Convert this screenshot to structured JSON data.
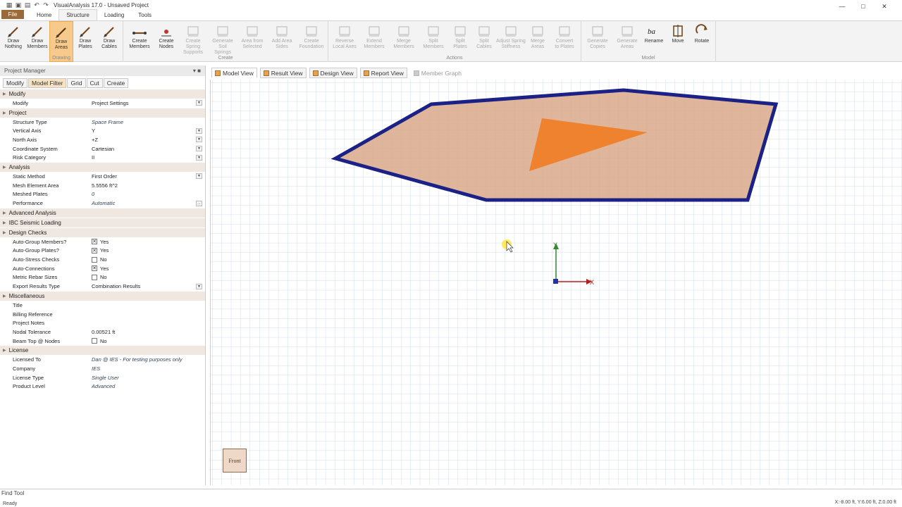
{
  "title_bar": {
    "app_title": "VisualAnalysis 17.0 - Unsaved Project",
    "qat_icons": [
      "app-icon",
      "save-icon",
      "save-all-icon",
      "undo-icon",
      "redo-icon"
    ],
    "window_controls": [
      "minimize-icon",
      "maximize-icon",
      "close-icon"
    ]
  },
  "ribbon_tabs": {
    "file": "File",
    "tabs": [
      {
        "label": "Home",
        "active": false
      },
      {
        "label": "Structure",
        "active": true
      },
      {
        "label": "Loading",
        "active": false
      },
      {
        "label": "Tools",
        "active": false
      }
    ]
  },
  "ribbon": {
    "groups": [
      {
        "label": "Drawing",
        "buttons": [
          {
            "label": "Draw\nNothing",
            "icon": "pencil-icon",
            "enabled": true,
            "active": false
          },
          {
            "label": "Draw\nMembers",
            "icon": "draw-member-icon",
            "enabled": true,
            "active": false
          },
          {
            "label": "Draw\nAreas",
            "icon": "draw-area-icon",
            "enabled": true,
            "active": true
          },
          {
            "label": "Draw\nPlates",
            "icon": "draw-plate-icon",
            "enabled": true,
            "active": false
          },
          {
            "label": "Draw\nCables",
            "icon": "draw-cable-icon",
            "enabled": true,
            "active": false
          }
        ]
      },
      {
        "label": "Create",
        "buttons": [
          {
            "label": "Create\nMembers",
            "icon": "create-members-icon",
            "enabled": true,
            "active": false
          },
          {
            "label": "Create\nNodes",
            "icon": "create-nodes-icon",
            "enabled": true,
            "active": false
          },
          {
            "label": "Create Spring\nSupports",
            "icon": "spring-support-icon",
            "enabled": false,
            "active": false
          },
          {
            "label": "Generate Soil\nSprings",
            "icon": "soil-spring-icon",
            "enabled": false,
            "active": false
          },
          {
            "label": "Area from\nSelected",
            "icon": "area-from-selected-icon",
            "enabled": false,
            "active": false
          },
          {
            "label": "Add Area\nSides",
            "icon": "add-area-sides-icon",
            "enabled": false,
            "active": false
          },
          {
            "label": "Create\nFoundation",
            "icon": "foundation-icon",
            "enabled": false,
            "active": false
          }
        ]
      },
      {
        "label": "Actions",
        "buttons": [
          {
            "label": "Reverse\nLocal Axes",
            "icon": "reverse-axes-icon",
            "enabled": false,
            "active": false
          },
          {
            "label": "Extend\nMembers",
            "icon": "extend-members-icon",
            "enabled": false,
            "active": false
          },
          {
            "label": "Merge\nMembers",
            "icon": "merge-members-icon",
            "enabled": false,
            "active": false
          },
          {
            "label": "Split\nMembers",
            "icon": "split-members-icon",
            "enabled": false,
            "active": false
          },
          {
            "label": "Split\nPlates",
            "icon": "split-plates-icon",
            "enabled": false,
            "active": false
          },
          {
            "label": "Split\nCables",
            "icon": "split-cables-icon",
            "enabled": false,
            "active": false
          },
          {
            "label": "Adjust Spring\nStiffness",
            "icon": "spring-stiffness-icon",
            "enabled": false,
            "active": false
          },
          {
            "label": "Merge\nAreas",
            "icon": "merge-areas-icon",
            "enabled": false,
            "active": false
          },
          {
            "label": "Convert\nto Plates",
            "icon": "convert-plates-icon",
            "enabled": false,
            "active": false
          }
        ]
      },
      {
        "label": "Model",
        "buttons": [
          {
            "label": "Generate\nCopies",
            "icon": "generate-copies-icon",
            "enabled": false,
            "active": false
          },
          {
            "label": "Generate\nAreas",
            "icon": "generate-areas-icon",
            "enabled": false,
            "active": false
          },
          {
            "label": "Rename",
            "icon": "rename-icon",
            "enabled": true,
            "active": false
          },
          {
            "label": "Move",
            "icon": "move-icon",
            "enabled": true,
            "active": false
          },
          {
            "label": "Rotate",
            "icon": "rotate-icon",
            "enabled": true,
            "active": false
          }
        ]
      }
    ]
  },
  "project_manager": {
    "title": "Project Manager",
    "tabs": [
      {
        "label": "Modify",
        "active": false
      },
      {
        "label": "Model Filter",
        "active": true
      },
      {
        "label": "Grid",
        "active": false
      },
      {
        "label": "Cut",
        "active": false
      },
      {
        "label": "Create",
        "active": false
      }
    ],
    "sections": [
      {
        "title": "Modify",
        "rows": [
          {
            "key": "Modify",
            "value": "Project Settings",
            "type": "dropdown",
            "italic": false
          }
        ]
      },
      {
        "title": "Project",
        "rows": [
          {
            "key": "Structure Type",
            "value": "Space Frame",
            "type": "text",
            "italic": true
          },
          {
            "key": "Vertical Axis",
            "value": "Y",
            "type": "dropdown",
            "italic": false
          },
          {
            "key": "North Axis",
            "value": "+Z",
            "type": "dropdown",
            "italic": false
          },
          {
            "key": "Coordinate System",
            "value": "Cartesian",
            "type": "dropdown",
            "italic": false
          },
          {
            "key": "Risk Category",
            "value": "II",
            "type": "dropdown",
            "italic": false
          }
        ]
      },
      {
        "title": "Analysis",
        "rows": [
          {
            "key": "Static Method",
            "value": "First Order",
            "type": "dropdown",
            "italic": false
          },
          {
            "key": "Mesh Element Area",
            "value": "5.5556 ft^2",
            "type": "text",
            "italic": false
          },
          {
            "key": "Meshed Plates",
            "value": "0",
            "type": "text",
            "italic": true
          },
          {
            "key": "Performance",
            "value": "Automatic",
            "type": "ellipsis",
            "italic": true
          }
        ]
      },
      {
        "title": "Advanced Analysis",
        "rows": []
      },
      {
        "title": "IBC Seismic Loading",
        "rows": []
      },
      {
        "title": "Design Checks",
        "rows": [
          {
            "key": "Auto-Group Members?",
            "value": "Yes",
            "type": "checkbox",
            "checked": true,
            "italic": false
          },
          {
            "key": "Auto-Group Plates?",
            "value": "Yes",
            "type": "checkbox",
            "checked": true,
            "italic": false
          },
          {
            "key": "Auto-Stress Checks",
            "value": "No",
            "type": "checkbox",
            "checked": false,
            "italic": false
          },
          {
            "key": "Auto-Connections",
            "value": "Yes",
            "type": "checkbox",
            "checked": true,
            "italic": false
          },
          {
            "key": "Metric Rebar Sizes",
            "value": "No",
            "type": "checkbox",
            "checked": false,
            "italic": false
          },
          {
            "key": "Export Results Type",
            "value": "Combination Results",
            "type": "dropdown",
            "italic": false
          }
        ]
      },
      {
        "title": "Miscellaneous",
        "rows": [
          {
            "key": "Title",
            "value": "",
            "type": "text",
            "italic": false
          },
          {
            "key": "Billing Reference",
            "value": "",
            "type": "text",
            "italic": false
          },
          {
            "key": "Project Notes",
            "value": "",
            "type": "text",
            "italic": false
          },
          {
            "key": "Nodal Tolerance",
            "value": "0.00521 ft",
            "type": "text",
            "italic": false
          },
          {
            "key": "Beam Top @ Nodes",
            "value": "No",
            "type": "checkbox",
            "checked": false,
            "italic": false
          }
        ]
      },
      {
        "title": "License",
        "rows": [
          {
            "key": "Licensed To",
            "value": "Dan @ IES - For testing purposes only",
            "type": "text",
            "italic": true
          },
          {
            "key": "Company",
            "value": "IES",
            "type": "text",
            "italic": true
          },
          {
            "key": "License Type",
            "value": "Single User",
            "type": "text",
            "italic": true
          },
          {
            "key": "Product Level",
            "value": "Advanced",
            "type": "text",
            "italic": true
          }
        ]
      }
    ]
  },
  "view_tabs": [
    {
      "label": "Model View",
      "icon": "model-view-icon",
      "active": true,
      "enabled": true
    },
    {
      "label": "Result View",
      "icon": "result-view-icon",
      "active": false,
      "enabled": true
    },
    {
      "label": "Design View",
      "icon": "design-view-icon",
      "active": false,
      "enabled": true
    },
    {
      "label": "Report View",
      "icon": "report-view-icon",
      "active": false,
      "enabled": true
    },
    {
      "label": "Member Graph",
      "icon": "member-graph-icon",
      "active": false,
      "enabled": false
    }
  ],
  "canvas": {
    "view_cube_label": "Front",
    "axis_labels": {
      "y": "Y",
      "x": "X"
    },
    "colors": {
      "area_outline": "#1c2185",
      "area_fill": "#d9a98a",
      "triangle_fill": "#f07c22",
      "grid": "#c8d4e6",
      "y_axis": "#2e8b2e",
      "x_axis": "#b32020"
    }
  },
  "find_tool": "Find Tool",
  "status_bar": {
    "status": "Ready",
    "coords": "X:-8.00 ft, Y:6.00 ft, Z:0.00 ft"
  }
}
